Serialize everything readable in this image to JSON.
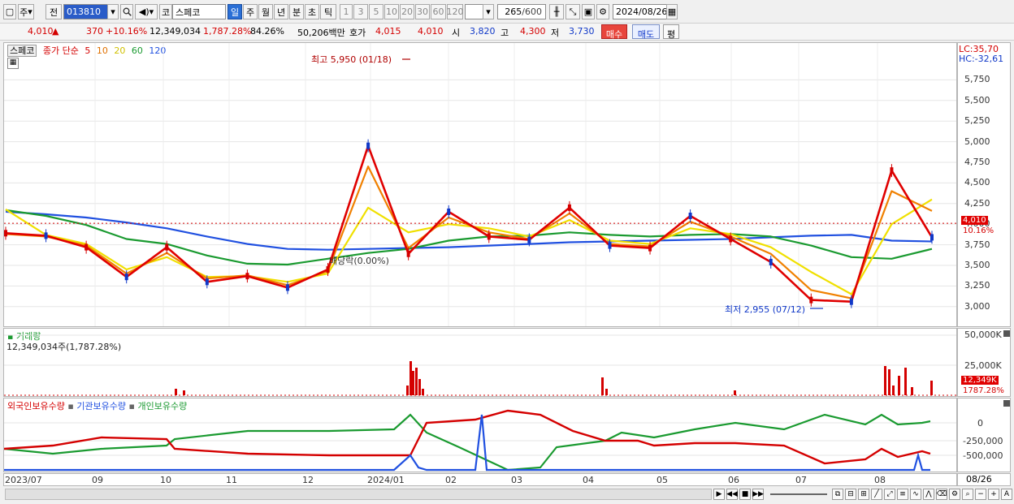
{
  "toolbar": {
    "mode_label": "주",
    "prev_label": "전",
    "code_value": "013810",
    "market_label": "코",
    "name_value": "스페코",
    "periods": [
      "일",
      "주",
      "월",
      "년",
      "분",
      "초",
      "틱"
    ],
    "selected_period": "일",
    "intervals": [
      "1",
      "3",
      "5",
      "10",
      "20",
      "30",
      "60",
      "120"
    ],
    "count_value": "265",
    "count_total": "/600",
    "date_value": "2024/08/26"
  },
  "quote": {
    "price": "4,010",
    "direction": "▲",
    "change": "370",
    "change_pct": "+10.16%",
    "volume": "12,349,034",
    "volume_pct": "1,787.28%",
    "volume_pct2": "84.26%",
    "amount": "50,206백만",
    "hoga_label": "호가",
    "hoga_value": "4,015",
    "hoga_value2": "4,010",
    "open_label": "시",
    "open_value": "3,820",
    "high_label": "고",
    "high_value": "4,300",
    "low_label": "저",
    "low_value": "3,730",
    "buy_button": "매수",
    "sell_button": "매도",
    "eval_button": "평"
  },
  "price_panel": {
    "legend_name": "스페코",
    "legend_series": "종가 단순",
    "ma_periods": [
      "5",
      "10",
      "20",
      "60",
      "120"
    ],
    "ma_colors": [
      "#e00000",
      "#f08000",
      "#f0e000",
      "#1a9a30",
      "#2050e0"
    ],
    "lc": "LC:35,70",
    "hc": "HC:-32,61",
    "high_annotation": "최고 5,950 (01/18)",
    "low_annotation": "최저 2,955 (07/12)",
    "dividend_annotation": "배당락(0.00%)",
    "scale_ticks": [
      "5,750",
      "5,500",
      "5,250",
      "5,000",
      "4,750",
      "4,500",
      "4,250",
      "4,000",
      "3,750",
      "3,500",
      "3,250",
      "3,000"
    ],
    "current_tag": "4,010",
    "current_pct_tag": "10.16%"
  },
  "volume_panel": {
    "title": "거래량",
    "value": "12,349,034주(1,787.28%)",
    "scale_ticks": [
      "50,000K",
      "25,000K"
    ],
    "current_tag": "12,349K",
    "current_pct_tag": "1787.28%"
  },
  "holding_panel": {
    "legend": [
      "외국인보유수량",
      "기관보유수량",
      "개인보유수량"
    ],
    "legend_colors": [
      "#d40000",
      "#2050e0",
      "#1a9a30"
    ],
    "scale_ticks": [
      "0",
      "-250,000",
      "-500,000"
    ]
  },
  "x_axis": {
    "labels": [
      "2023/07",
      "09",
      "10",
      "11",
      "12",
      "2024/01",
      "02",
      "03",
      "04",
      "05",
      "06",
      "07",
      "08"
    ],
    "end_label": "08/26"
  },
  "chart_data": {
    "type": "line",
    "title": "",
    "series": [
      {
        "name": "5",
        "values": [
          3890,
          3860,
          3720,
          3360,
          3720,
          3300,
          3370,
          3230,
          3450,
          4950,
          3640,
          4150,
          3850,
          3810,
          4200,
          3740,
          3710,
          4100,
          3820,
          3540,
          3080,
          3060,
          4650,
          3840
        ]
      },
      {
        "name": "10",
        "values": [
          3880,
          3850,
          3740,
          3400,
          3650,
          3340,
          3380,
          3260,
          3430,
          4700,
          3710,
          4080,
          3900,
          3820,
          4130,
          3760,
          3730,
          4030,
          3850,
          3640,
          3200,
          3100,
          4400,
          4160
        ]
      },
      {
        "name": "20",
        "values": [
          4180,
          3870,
          3760,
          3450,
          3600,
          3360,
          3370,
          3300,
          3400,
          4200,
          3900,
          4000,
          3950,
          3850,
          4050,
          3800,
          3760,
          3950,
          3880,
          3720,
          3420,
          3150,
          4000,
          4300
        ]
      },
      {
        "name": "60",
        "values": [
          4170,
          4100,
          3990,
          3820,
          3760,
          3620,
          3520,
          3510,
          3580,
          3650,
          3700,
          3800,
          3850,
          3860,
          3900,
          3870,
          3850,
          3870,
          3880,
          3850,
          3740,
          3600,
          3580,
          3700
        ]
      },
      {
        "name": "120",
        "values": [
          4150,
          4120,
          4080,
          4020,
          3950,
          3850,
          3760,
          3700,
          3690,
          3700,
          3710,
          3720,
          3740,
          3760,
          3780,
          3790,
          3800,
          3810,
          3820,
          3840,
          3860,
          3870,
          3800,
          3790
        ]
      }
    ],
    "x_period": [
      "2023/07",
      "",
      "09",
      "10",
      "",
      "11",
      "12",
      "",
      "2024/01",
      "",
      "02",
      "03",
      "",
      "04",
      "05",
      "",
      "06",
      "",
      "07",
      "",
      "",
      "08",
      "",
      "08/26"
    ],
    "ylim": [
      2850,
      6000
    ]
  }
}
